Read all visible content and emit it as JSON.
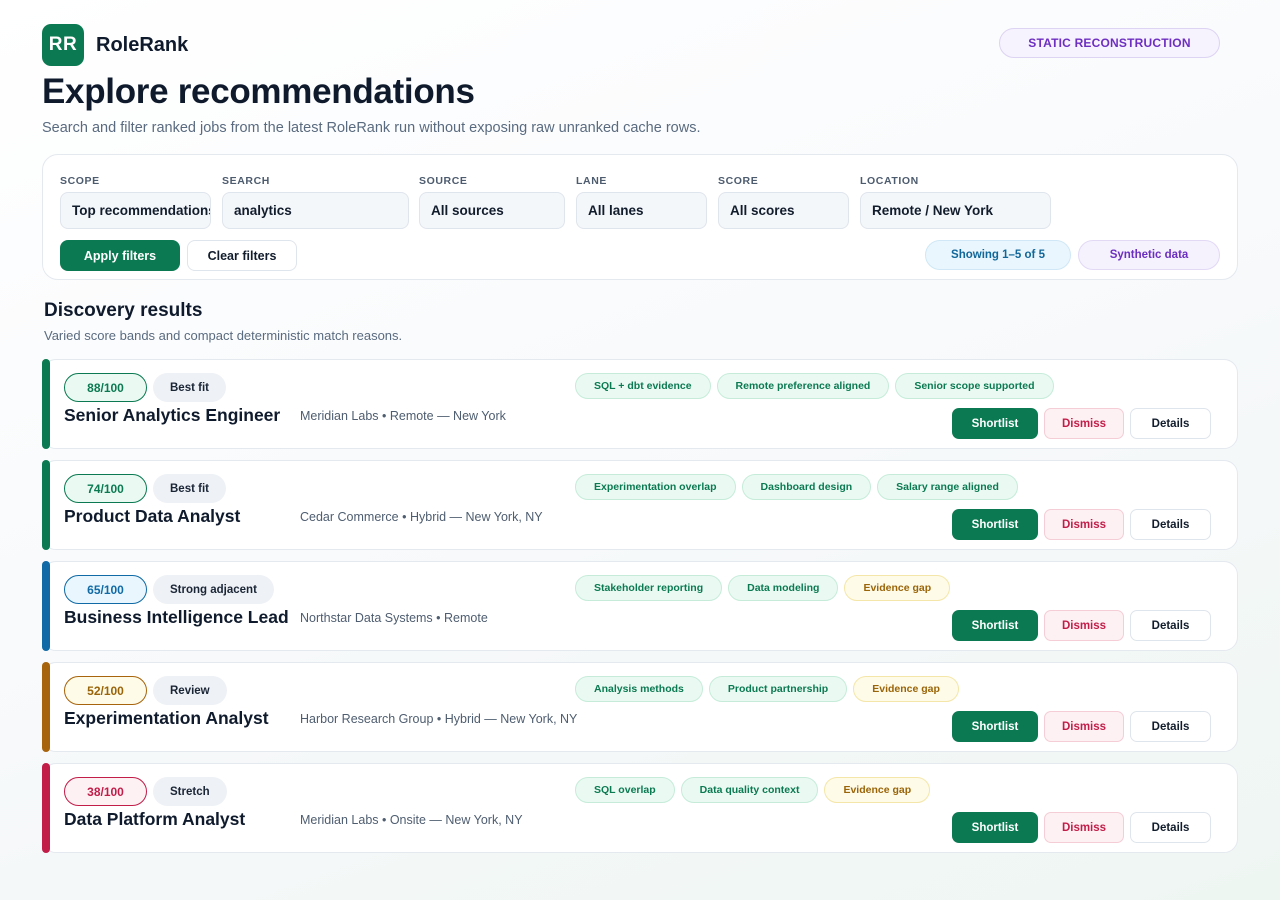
{
  "brand": {
    "logo_text": "RR",
    "name": "RoleRank"
  },
  "status_badge": "STATIC RECONSTRUCTION",
  "page": {
    "title": "Explore recommendations",
    "subtitle": "Search and filter ranked jobs from the latest RoleRank run without exposing raw unranked cache rows."
  },
  "filters": {
    "scope": {
      "label": "SCOPE",
      "value": "Top recommendations"
    },
    "search": {
      "label": "SEARCH",
      "value": "analytics"
    },
    "source": {
      "label": "SOURCE",
      "value": "All sources"
    },
    "lane": {
      "label": "LANE",
      "value": "All lanes"
    },
    "score": {
      "label": "SCORE",
      "value": "All scores"
    },
    "location": {
      "label": "LOCATION",
      "value": "Remote / New York"
    },
    "apply_label": "Apply filters",
    "clear_label": "Clear filters",
    "showing": "Showing 1–5 of 5",
    "synthetic": "Synthetic data"
  },
  "results": {
    "title": "Discovery results",
    "subtitle": "Varied score bands and compact deterministic match reasons.",
    "action_labels": {
      "shortlist": "Shortlist",
      "dismiss": "Dismiss",
      "details": "Details"
    },
    "items": [
      {
        "score": "88/100",
        "band": "Best fit",
        "title": "Senior Analytics Engineer",
        "meta": "Meridian Labs • Remote — New York",
        "accent": "#0b7a52",
        "score_bg": "#eafaf3",
        "score_border": "#0b7a52",
        "score_text": "#0b7a52",
        "tags": [
          {
            "text": "SQL + dbt evidence",
            "kind": "ok"
          },
          {
            "text": "Remote preference aligned",
            "kind": "ok"
          },
          {
            "text": "Senior scope supported",
            "kind": "ok"
          }
        ]
      },
      {
        "score": "74/100",
        "band": "Best fit",
        "title": "Product Data Analyst",
        "meta": "Cedar Commerce • Hybrid — New York, NY",
        "accent": "#0b7a52",
        "score_bg": "#eafaf3",
        "score_border": "#0b7a52",
        "score_text": "#0b7a52",
        "tags": [
          {
            "text": "Experimentation overlap",
            "kind": "ok"
          },
          {
            "text": "Dashboard design",
            "kind": "ok"
          },
          {
            "text": "Salary range aligned",
            "kind": "ok"
          }
        ]
      },
      {
        "score": "65/100",
        "band": "Strong adjacent",
        "title": "Business Intelligence Lead",
        "meta": "Northstar Data Systems • Remote",
        "accent": "#0f6aa6",
        "score_bg": "#eaf6fd",
        "score_border": "#0f6aa6",
        "score_text": "#0f6aa6",
        "tags": [
          {
            "text": "Stakeholder reporting",
            "kind": "ok"
          },
          {
            "text": "Data modeling",
            "kind": "ok"
          },
          {
            "text": "Evidence gap",
            "kind": "gap"
          }
        ]
      },
      {
        "score": "52/100",
        "band": "Review",
        "title": "Experimentation Analyst",
        "meta": "Harbor Research Group • Hybrid — New York, NY",
        "accent": "#a8640c",
        "score_bg": "#fefbe9",
        "score_border": "#a8640c",
        "score_text": "#9a6408",
        "tags": [
          {
            "text": "Analysis methods",
            "kind": "ok"
          },
          {
            "text": "Product partnership",
            "kind": "ok"
          },
          {
            "text": "Evidence gap",
            "kind": "gap"
          }
        ]
      },
      {
        "score": "38/100",
        "band": "Stretch",
        "title": "Data Platform Analyst",
        "meta": "Meridian Labs • Onsite — New York, NY",
        "accent": "#c21d49",
        "score_bg": "#fdf1f3",
        "score_border": "#c21d49",
        "score_text": "#c21d49",
        "tags": [
          {
            "text": "SQL overlap",
            "kind": "ok"
          },
          {
            "text": "Data quality context",
            "kind": "ok"
          },
          {
            "text": "Evidence gap",
            "kind": "gap"
          }
        ]
      }
    ]
  }
}
